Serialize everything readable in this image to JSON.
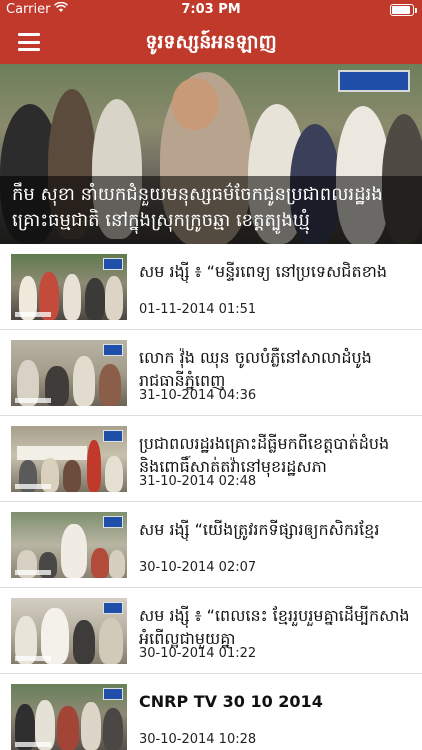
{
  "status_bar": {
    "carrier": "Carrier",
    "time": "7:03 PM",
    "battery_level": 1.0
  },
  "nav": {
    "title": "ទូរទស្សន៍អនឡាញ"
  },
  "hero": {
    "caption": "កឹម សុខា នាំយកជំនួយមនុស្សធម៌ចែកជូនប្រជាពលរដ្ឋរងគ្រោះធម្មជាតិ នៅក្នុងស្រុកក្រូចឆ្មា ខេត្តត្បូងឃ្មុំ"
  },
  "news": [
    {
      "headline": "សម រង្ស៊ី ៖ “មន្ទីរពេទ្យ នៅប្រទេសជិតខាង",
      "date": "01-11-2014 01:51"
    },
    {
      "headline": "លោក វ៉ុង ឈុន ចូលបំភ្លឺនៅសាលាដំបូងរាជធានីភ្នំពេញ",
      "date": "31-10-2014 04:36"
    },
    {
      "headline": "ប្រជាពលរដ្ឋរងគ្រោះដីធ្លីមកពីខេត្តបាត់ដំបង និងពោធិ៍សាត់តវ៉ានៅមុខរដ្ឋសភា",
      "date": "31-10-2014 02:48"
    },
    {
      "headline": "សម រង្ស៊ី “យើងត្រូវរកទីផ្សារឲ្យកសិករខ្មែរ",
      "date": "30-10-2014 02:07"
    },
    {
      "headline": "សម រង្ស៊ី ៖ “ពេលនេះ ខ្មែររួបរួមគ្នាដើម្បីកសាងអំពើល្អជាមួយគ្នា",
      "date": "30-10-2014 01:22"
    },
    {
      "headline": "CNRP TV 30 10 2014",
      "date": "30-10-2014 10:28"
    }
  ],
  "colors": {
    "brand": "#c0392b"
  },
  "icons": {
    "menu": "hamburger-menu-icon",
    "wifi": "wifi-icon",
    "battery": "battery-icon"
  }
}
